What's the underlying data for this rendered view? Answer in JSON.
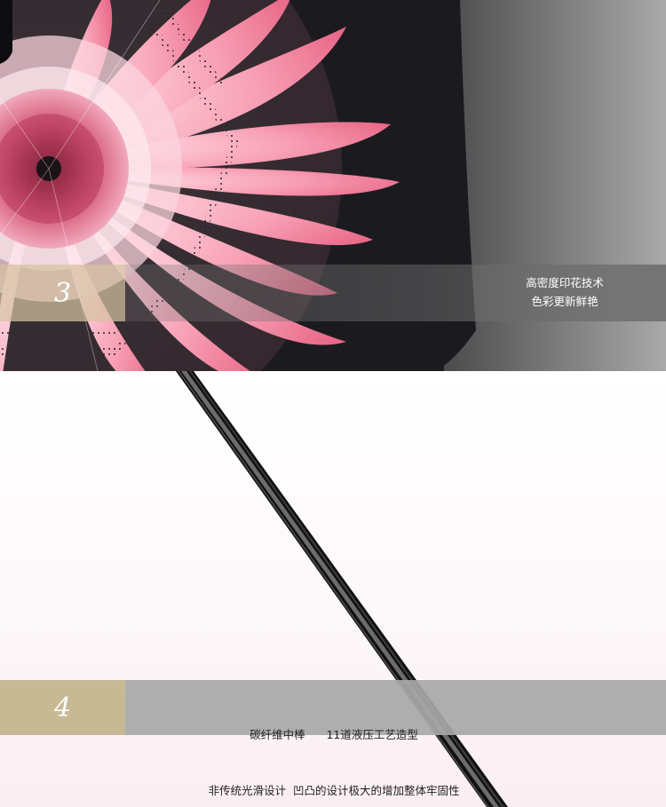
{
  "section_3": {
    "number": "3",
    "text_lines": [
      "高密度印花技术",
      "色彩更新鲜艳"
    ]
  },
  "section_4": {
    "number": "4",
    "text_lines": [
      "碳纤维中棒      11道液压工艺造型",
      "非传统光滑设计  凹凸的设计极大的增加整体牢固性"
    ]
  },
  "colors": {
    "band_number_bg": "#c8b995",
    "flower_pink": "#f07c98",
    "canopy_black": "#1b1b1f"
  }
}
